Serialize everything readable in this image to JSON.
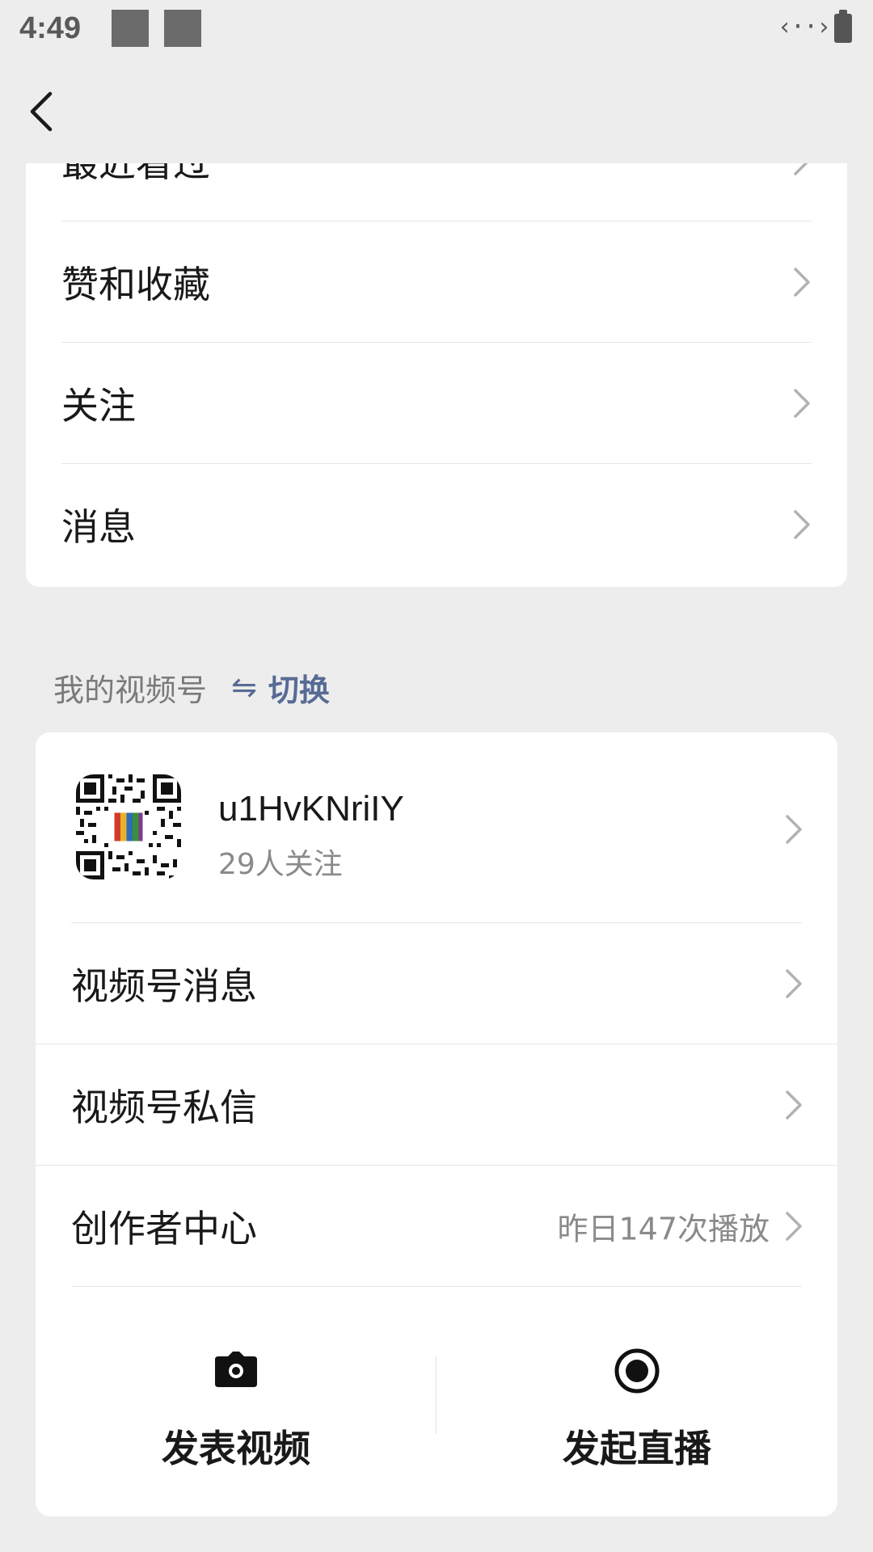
{
  "status_bar": {
    "time": "4:49",
    "data_icon": "‹··›",
    "icons": [
      "notification-square-icon",
      "notification-square-icon",
      "data-transfer-icon",
      "battery-icon"
    ]
  },
  "nav": {
    "back_icon": "chevron-left-icon"
  },
  "top_menu": {
    "items": [
      {
        "label": "最近看过"
      },
      {
        "label": "赞和收藏"
      },
      {
        "label": "关注"
      },
      {
        "label": "消息"
      }
    ]
  },
  "channel_section": {
    "title": "我的视频号",
    "switch_icon": "⇋",
    "switch_label": "切换"
  },
  "channel": {
    "name": "u1HvKNriIY",
    "followers": "29人关注",
    "rows": [
      {
        "label": "视频号消息",
        "value": ""
      },
      {
        "label": "视频号私信",
        "value": ""
      },
      {
        "label": "创作者中心",
        "value": "昨日147次播放"
      }
    ],
    "actions": [
      {
        "label": "发表视频",
        "icon": "camera-icon"
      },
      {
        "label": "发起直播",
        "icon": "live-record-icon"
      }
    ]
  },
  "colors": {
    "background": "#ededed",
    "card": "#ffffff",
    "link": "#576b95",
    "secondary_text": "#8a8a8a"
  }
}
